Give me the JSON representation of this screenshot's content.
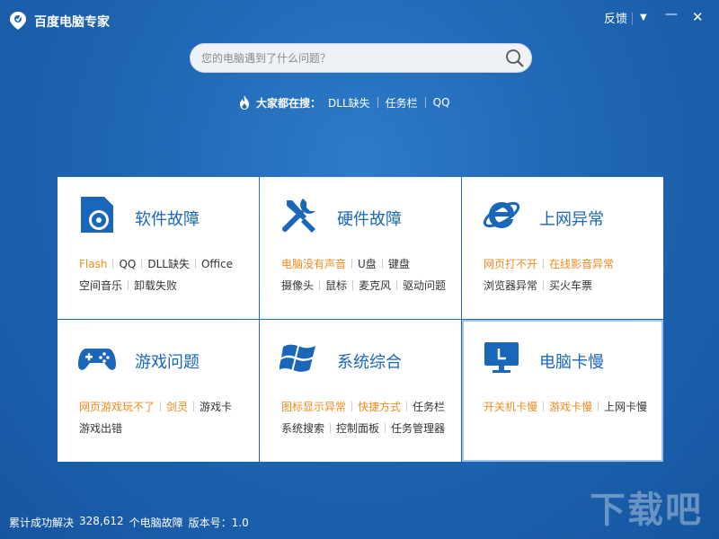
{
  "app": {
    "title": "百度电脑专家"
  },
  "window_controls": {
    "feedback": "反馈",
    "menu": "▼",
    "minimize": "—",
    "close": "✕"
  },
  "search": {
    "placeholder": "您的电脑遇到了什么问题？",
    "value": ""
  },
  "hot_search": {
    "label": "大家都在搜：",
    "items": [
      "DLL缺失",
      "任务栏",
      "QQ"
    ]
  },
  "cards": [
    {
      "title": "软件故障",
      "icon": "disc-icon",
      "lines": [
        [
          {
            "text": "Flash",
            "color": "orange"
          },
          {
            "text": "QQ",
            "color": "gray"
          },
          {
            "text": "DLL缺失",
            "color": "gray"
          },
          {
            "text": "Office",
            "color": "gray"
          }
        ],
        [
          {
            "text": "空间音乐",
            "color": "gray"
          },
          {
            "text": "卸载失败",
            "color": "gray"
          }
        ]
      ]
    },
    {
      "title": "硬件故障",
      "icon": "tools-icon",
      "lines": [
        [
          {
            "text": "电脑没有声音",
            "color": "orange"
          },
          {
            "text": "U盘",
            "color": "gray"
          },
          {
            "text": "键盘",
            "color": "gray"
          }
        ],
        [
          {
            "text": "摄像头",
            "color": "gray"
          },
          {
            "text": "鼠标",
            "color": "gray"
          },
          {
            "text": "麦克风",
            "color": "gray"
          },
          {
            "text": "驱动问题",
            "color": "gray"
          }
        ]
      ]
    },
    {
      "title": "上网异常",
      "icon": "ie-icon",
      "lines": [
        [
          {
            "text": "网页打不开",
            "color": "orange"
          },
          {
            "text": "在线影音异常",
            "color": "orange"
          }
        ],
        [
          {
            "text": "浏览器异常",
            "color": "gray"
          },
          {
            "text": "买火车票",
            "color": "gray"
          }
        ]
      ]
    },
    {
      "title": "游戏问题",
      "icon": "gamepad-icon",
      "lines": [
        [
          {
            "text": "网页游戏玩不了",
            "color": "orange"
          },
          {
            "text": "剑灵",
            "color": "orange"
          },
          {
            "text": "游戏卡",
            "color": "gray"
          }
        ],
        [
          {
            "text": "游戏出错",
            "color": "gray"
          }
        ]
      ]
    },
    {
      "title": "系统综合",
      "icon": "windows-icon",
      "lines": [
        [
          {
            "text": "图标显示异常",
            "color": "orange"
          },
          {
            "text": "快捷方式",
            "color": "orange"
          },
          {
            "text": "任务栏",
            "color": "gray"
          }
        ],
        [
          {
            "text": "系统搜索",
            "color": "gray"
          },
          {
            "text": "控制面板",
            "color": "gray"
          },
          {
            "text": "任务管理器",
            "color": "gray"
          }
        ]
      ]
    },
    {
      "title": "电脑卡慢",
      "icon": "monitor-icon",
      "lines": [
        [
          {
            "text": "开关机卡慢",
            "color": "orange"
          },
          {
            "text": "游戏卡慢",
            "color": "orange"
          },
          {
            "text": "上网卡慢",
            "color": "gray"
          }
        ]
      ]
    }
  ],
  "status": {
    "label": "累计成功解决",
    "count": "328,612",
    "unit": "个电脑故障",
    "version": "版本号：1.0"
  },
  "watermark": "下载吧",
  "colors": {
    "accent": "#1a66b8",
    "orange": "#f08a1c",
    "background": "#1f66b3"
  }
}
